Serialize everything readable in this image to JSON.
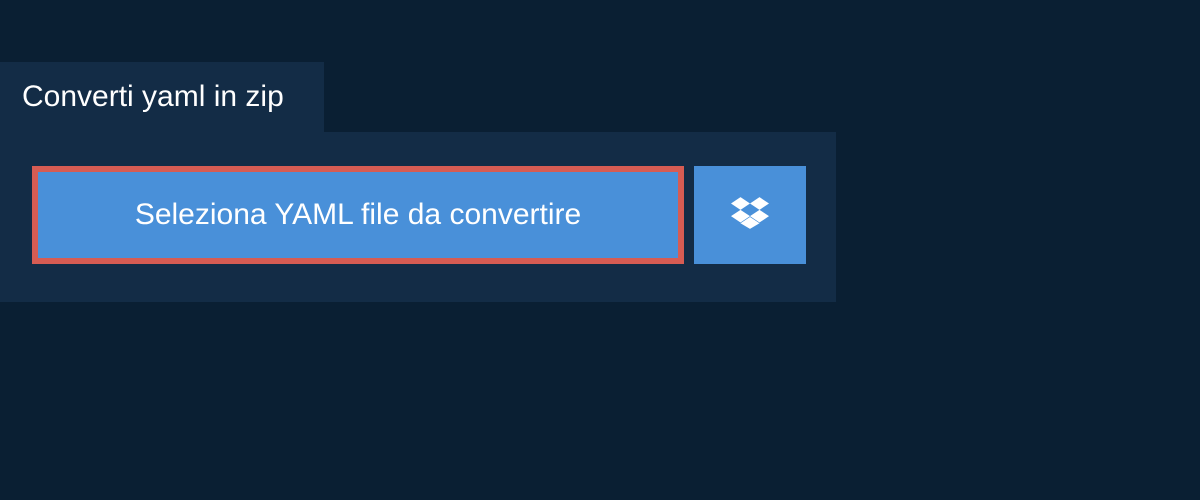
{
  "tab": {
    "label": "Converti yaml in zip"
  },
  "actions": {
    "select_file_label": "Seleziona YAML file da convertire"
  }
}
